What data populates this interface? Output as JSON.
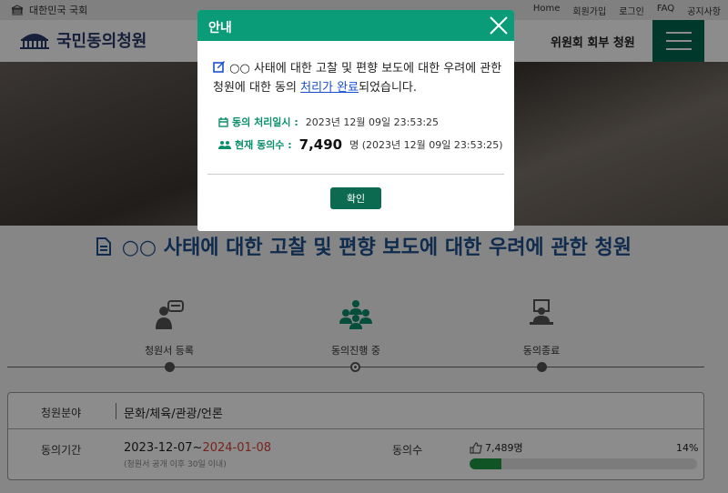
{
  "topbar": {
    "brand": "대한민국 국회",
    "links": [
      "Home",
      "회원가입",
      "로그인",
      "FAQ",
      "공지사항"
    ]
  },
  "header": {
    "logo_text": "국민동의청원",
    "right_label": "위원회 회부 청원",
    "menu_icon": "hamburger-icon"
  },
  "petition": {
    "title": "○○ 사태에 대한 고찰 및 편향 보도에 대한 우려에 관한 청원",
    "steps": [
      {
        "label": "청원서 등록",
        "icon": "petition-register-icon"
      },
      {
        "label": "동의진행 중",
        "icon": "people-group-icon",
        "active": true
      },
      {
        "label": "동의종료",
        "icon": "presenter-icon"
      }
    ],
    "category_label": "청원분야",
    "category_value": "문화/체육/관광/언론",
    "period_label": "동의기간",
    "period_start": "2023-12-07~",
    "period_end": "2024-01-08",
    "period_note": "(청원서 공개 이후 30일 이내)",
    "votes_label": "동의수",
    "votes_count": "7,489명",
    "votes_percent": "14%",
    "progress_fraction": 0.14
  },
  "modal": {
    "title": "안내",
    "message_before": "○○ 사태에 대한 고찰 및 편향 보도에 대한 우려에 관한 청원에 대한 동의 ",
    "message_link": "처리가 완료",
    "message_after": "되었습니다.",
    "processed_at_label": "동의 처리일시 :",
    "processed_at_value": "2023년 12월 09일 23:53:25",
    "current_votes_label": "현재 동의수 :",
    "current_votes_value": "7,490",
    "current_votes_unit": "명 (2023년 12월 09일 23:53:25)",
    "confirm_label": "확인"
  },
  "colors": {
    "accent": "#0a9b78",
    "button": "#0b6a4f",
    "title_blue": "#1c4f8c",
    "end_date_red": "#d9413a",
    "progress": "#1e9a44"
  }
}
